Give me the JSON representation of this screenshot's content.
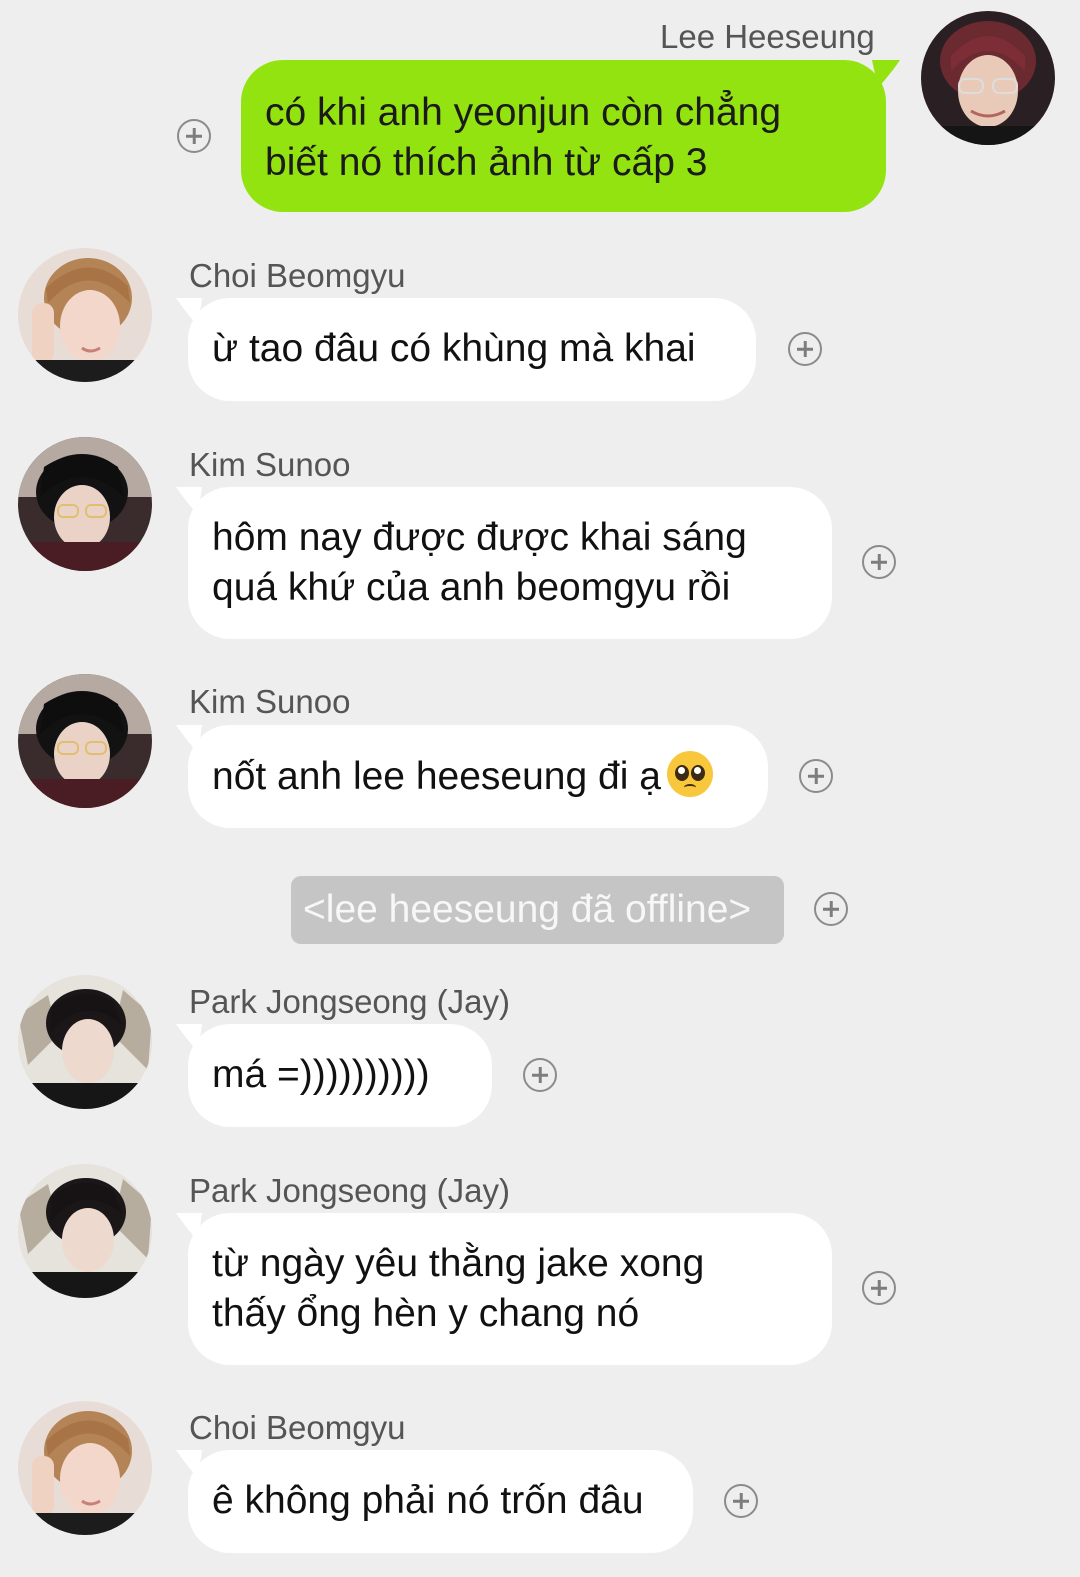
{
  "messages": [
    {
      "sender": "Lee Heeseung",
      "side": "out",
      "lines": [
        "có khi anh yeonjun còn chẳng",
        "biết nó thích ảnh từ cấp 3"
      ]
    },
    {
      "sender": "Choi Beomgyu",
      "side": "in",
      "lines": [
        "ừ tao đâu có khùng mà khai"
      ]
    },
    {
      "sender": "Kim Sunoo",
      "side": "in",
      "lines": [
        "hôm nay được được khai sáng",
        "quá khứ của anh beomgyu rồi"
      ]
    },
    {
      "sender": "Kim Sunoo",
      "side": "in",
      "lines": [
        "nốt anh lee heeseung đi ạ"
      ],
      "emoji": "pleading-face-emoji"
    },
    {
      "sender": "Park Jongseong (Jay)",
      "side": "in",
      "lines": [
        "má =))))))))))"
      ]
    },
    {
      "sender": "Park Jongseong (Jay)",
      "side": "in",
      "lines": [
        "từ ngày yêu thằng jake xong",
        "thấy ổng hèn y chang nó"
      ]
    },
    {
      "sender": "Choi Beomgyu",
      "side": "in",
      "lines": [
        "ê không phải nó trốn đâu"
      ]
    }
  ],
  "system_notice": "<lee heeseung đã offline>",
  "colors": {
    "background": "#eeeeee",
    "outgoing_bubble": "#93e310",
    "incoming_bubble": "#ffffff",
    "system_bubble": "#c5c5c5"
  },
  "icons": {
    "react": "plus-circle-icon"
  }
}
